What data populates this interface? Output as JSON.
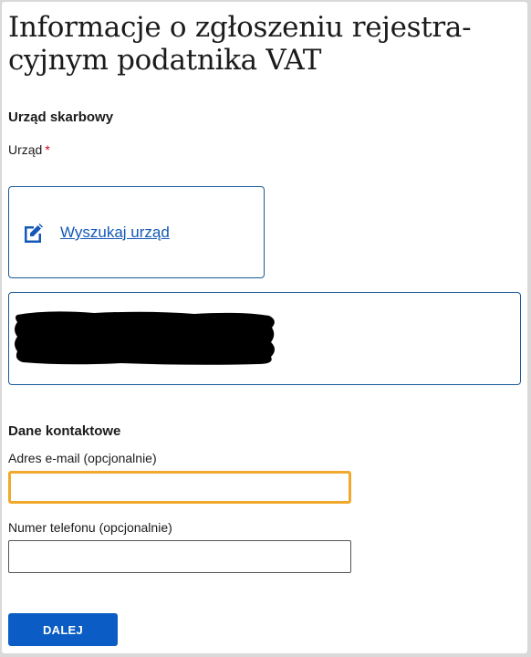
{
  "page": {
    "title": "Informacje o zgłoszeniu rejestra-cyjnym podatnika VAT",
    "title_line1": "Informacje o zgłoszeniu rejestra-",
    "title_line2": "cyjnym podatnika VAT"
  },
  "tax_office": {
    "heading": "Urząd skarbowy",
    "field_label": "Urząd",
    "required_marker": "*",
    "search_link_label": "Wyszukaj urząd",
    "search_icon": "edit-icon",
    "selected_office": "[redacted]"
  },
  "contact": {
    "heading": "Dane kontaktowe",
    "email_label": "Adres e-mail (opcjonalnie)",
    "email_value": "",
    "phone_label": "Numer telefonu (opcjonalnie)",
    "phone_value": ""
  },
  "actions": {
    "next_label": "DALEJ"
  },
  "colors": {
    "accent": "#0b5cc4",
    "link": "#1458b7",
    "focus": "#f0a92c",
    "required": "#d0021b",
    "box_border": "#1d5a9a"
  }
}
